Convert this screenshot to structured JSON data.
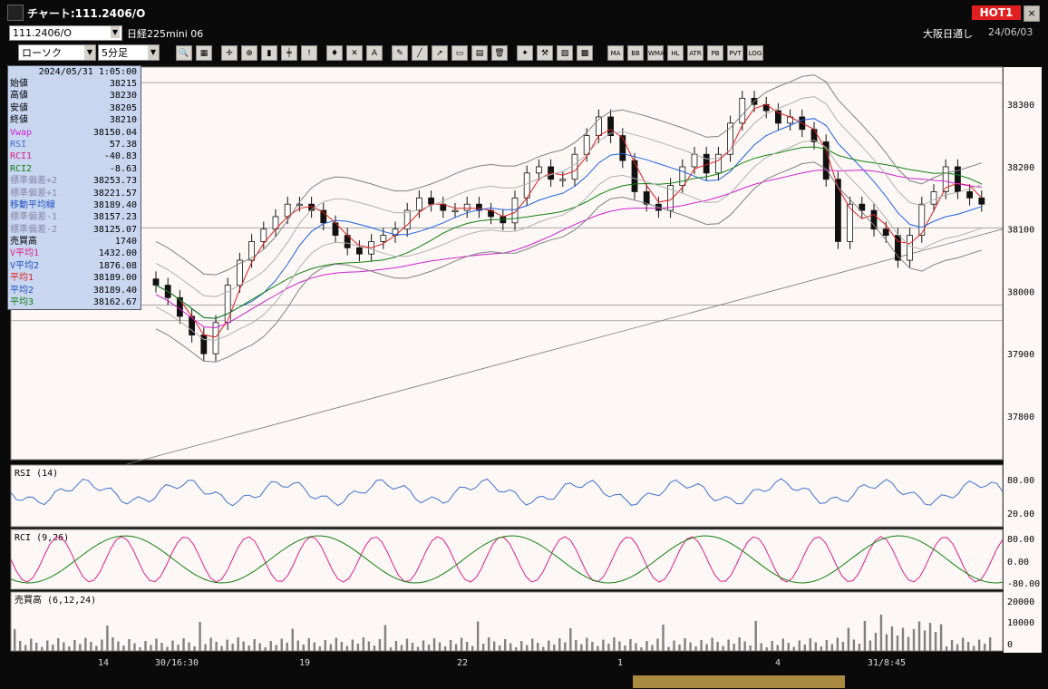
{
  "window": {
    "title": "チャート:111.2406/O",
    "hot_label": "HOT1",
    "close_glyph": "×"
  },
  "instrument": {
    "code": "111.2406/O",
    "name": "日経225mini 06",
    "market": "大阪日通し",
    "date": "24/06/03"
  },
  "toolbar": {
    "chart_type": "ローソク",
    "interval": "5分足",
    "buttons": [
      "zoom-icon",
      "grid-icon",
      "cursor-icon",
      "magnifier-icon",
      "bar-icon",
      "split-icon",
      "hint-icon",
      "candle-icon",
      "close-icon",
      "all-icon",
      "pen-icon",
      "line-icon",
      "arrow-icon",
      "shape-icon",
      "note-icon",
      "trash-icon",
      "gear-icon",
      "wrench-icon",
      "color-icon",
      "fill-icon"
    ],
    "indicator_labels": [
      "MA",
      "BB",
      "WMA",
      "HL",
      "ATR",
      "PB",
      "PVT",
      "LOG"
    ]
  },
  "colors": {
    "bg": "#fdf8f5",
    "candle": "#111111",
    "ma1": "#e02020",
    "ma2": "#2060e0",
    "ma3": "#108010",
    "vwap": "#d020d0",
    "bb": "#808080",
    "rsi": "#4070d0",
    "rci1": "#e0208a",
    "rci2": "#108010"
  },
  "panel": {
    "timestamp": "2024/05/31 1:05:00",
    "rows": [
      {
        "label": "始値",
        "value": "38215",
        "color": "#000000"
      },
      {
        "label": "高値",
        "value": "38230",
        "color": "#000000"
      },
      {
        "label": "安値",
        "value": "38205",
        "color": "#000000"
      },
      {
        "label": "終値",
        "value": "38210",
        "color": "#000000"
      },
      {
        "label": "Vwap",
        "value": "38150.04",
        "color": "#d020d0"
      },
      {
        "label": "RSI",
        "value": "57.38",
        "color": "#4070d0"
      },
      {
        "label": "RCI1",
        "value": "-40.83",
        "color": "#e0208a"
      },
      {
        "label": "RCI2",
        "value": "-8.63",
        "color": "#108010"
      },
      {
        "label": "標準偏差+2",
        "value": "38253.73",
        "color": "#8888a8"
      },
      {
        "label": "標準偏差+1",
        "value": "38221.57",
        "color": "#8888a8"
      },
      {
        "label": "移動平均線",
        "value": "38189.40",
        "color": "#2050c0"
      },
      {
        "label": "標準偏差-1",
        "value": "38157.23",
        "color": "#8888a8"
      },
      {
        "label": "標準偏差-2",
        "value": "38125.07",
        "color": "#8888a8"
      },
      {
        "label": "売買高",
        "value": "1740",
        "color": "#000000"
      },
      {
        "label": "V平均1",
        "value": "1432.00",
        "color": "#e0208a"
      },
      {
        "label": "V平均2",
        "value": "1876.08",
        "color": "#2050c0"
      },
      {
        "label": "平均1",
        "value": "38189.00",
        "color": "#e02020"
      },
      {
        "label": "平均2",
        "value": "38189.40",
        "color": "#2050c0"
      },
      {
        "label": "平均3",
        "value": "38162.67",
        "color": "#108010"
      }
    ]
  },
  "chart_data": {
    "type": "candlestick",
    "price_ticks": [
      "38300",
      "38200",
      "38100",
      "38000",
      "37900",
      "37800"
    ],
    "ylim": [
      37730,
      38360
    ],
    "x_ticks": [
      "14",
      "30/16:30",
      "19",
      "22",
      "1",
      "4",
      "31/8:45"
    ],
    "closes": [
      38010,
      37990,
      37960,
      37930,
      37900,
      37950,
      38010,
      38050,
      38080,
      38100,
      38120,
      38140,
      38140,
      38130,
      38110,
      38090,
      38070,
      38060,
      38080,
      38090,
      38100,
      38130,
      38150,
      38140,
      38130,
      38130,
      38140,
      38130,
      38120,
      38110,
      38150,
      38190,
      38200,
      38180,
      38180,
      38220,
      38250,
      38280,
      38250,
      38210,
      38160,
      38140,
      38130,
      38170,
      38200,
      38220,
      38190,
      38220,
      38270,
      38310,
      38300,
      38290,
      38270,
      38280,
      38260,
      38240,
      38180,
      38080,
      38140,
      38130,
      38100,
      38090,
      38050,
      38090,
      38140,
      38160,
      38200,
      38160,
      38150,
      38140
    ],
    "sub_panels": [
      {
        "name": "RSI (14)",
        "ticks": [
          "80.00",
          "20.00"
        ]
      },
      {
        "name": "RCI (9,26)",
        "ticks": [
          "80.00",
          "0.00",
          "-80.00"
        ]
      },
      {
        "name": "売買高 (6,12,24)",
        "ticks": [
          "20000",
          "10000",
          "0"
        ]
      }
    ]
  }
}
